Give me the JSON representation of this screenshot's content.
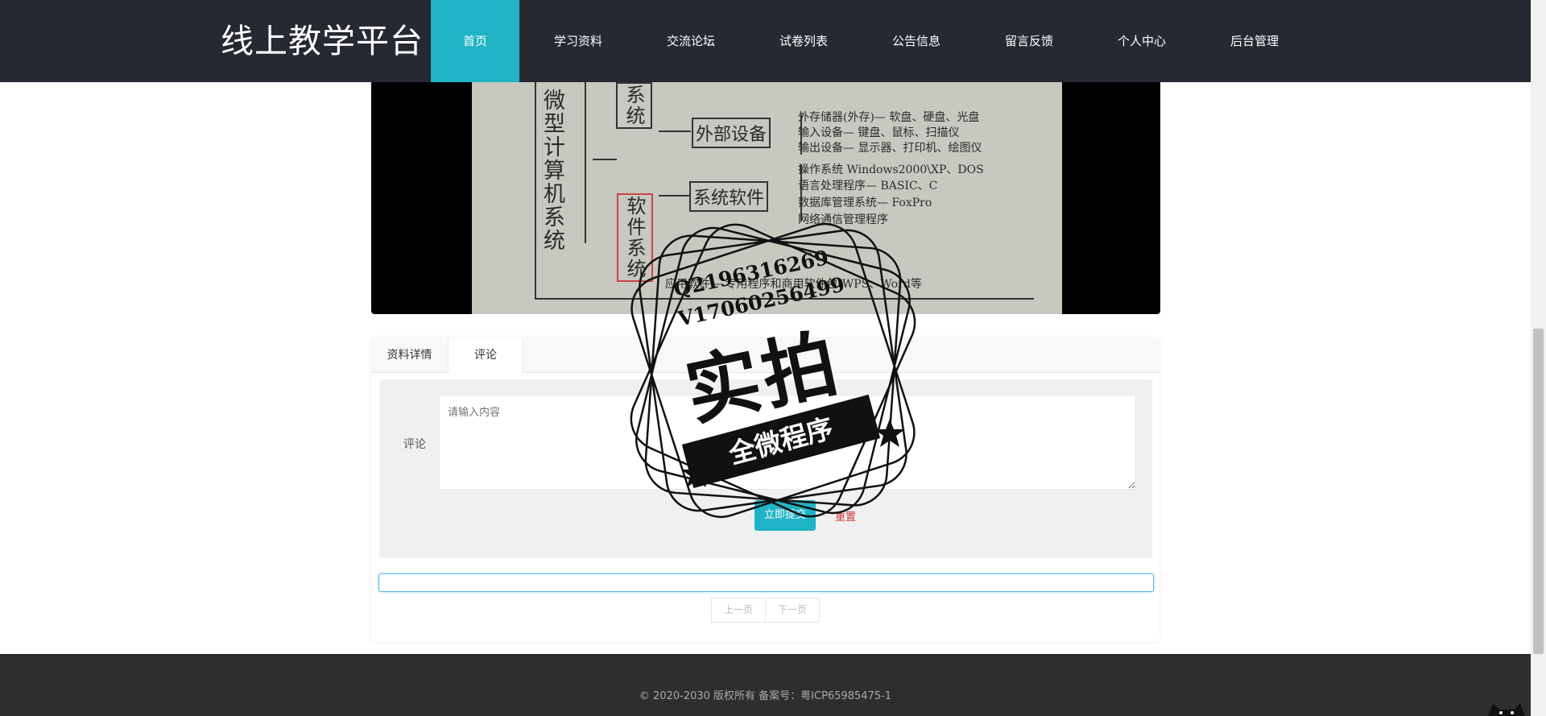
{
  "header": {
    "logo": "线上教学平台",
    "nav": [
      {
        "label": "首页",
        "active": true
      },
      {
        "label": "学习资料",
        "active": false
      },
      {
        "label": "交流论坛",
        "active": false
      },
      {
        "label": "试卷列表",
        "active": false
      },
      {
        "label": "公告信息",
        "active": false
      },
      {
        "label": "留言反馈",
        "active": false
      },
      {
        "label": "个人中心",
        "active": false
      },
      {
        "label": "后台管理",
        "active": false
      }
    ]
  },
  "video": {
    "left_vertical": "微型计算机系统",
    "box_system_top": "系统",
    "box_peripheral": "外部设备",
    "box_software": "软件系统",
    "box_system_software": "系统软件",
    "lines": [
      "外存储器(外存)— 软盘、硬盘、光盘",
      "输入设备— 键盘、鼠标、扫描仪",
      "输出设备— 显示器、打印机、绘图仪",
      "操作系统   Windows2000\\XP、DOS",
      "语言处理程序— BASIC、C",
      "数据库管理系统— FoxPro",
      "网络通信管理程序",
      "应用软件— 专用程序和商用软件包(WPS、Word等"
    ]
  },
  "tabs": [
    {
      "label": "资料详情",
      "active": false
    },
    {
      "label": "评论",
      "active": true
    }
  ],
  "comment_form": {
    "label": "评论",
    "placeholder": "请输入内容",
    "submit_label": "立即提交",
    "reset_label": "重置"
  },
  "pager": {
    "prev_label": "上一页",
    "next_label": "下一页"
  },
  "watermark": {
    "qq": "Q2196316269",
    "wechat": "V17060256499",
    "big_text": "实拍",
    "ribbon_text": "全微程序"
  },
  "footer": {
    "copyright": "© 2020-2030 版权所有 备案号：粤ICP65985475-1"
  },
  "colors": {
    "header_bg": "#262932",
    "accent": "#1fb4c5",
    "footer_bg": "#2e2e2e"
  }
}
